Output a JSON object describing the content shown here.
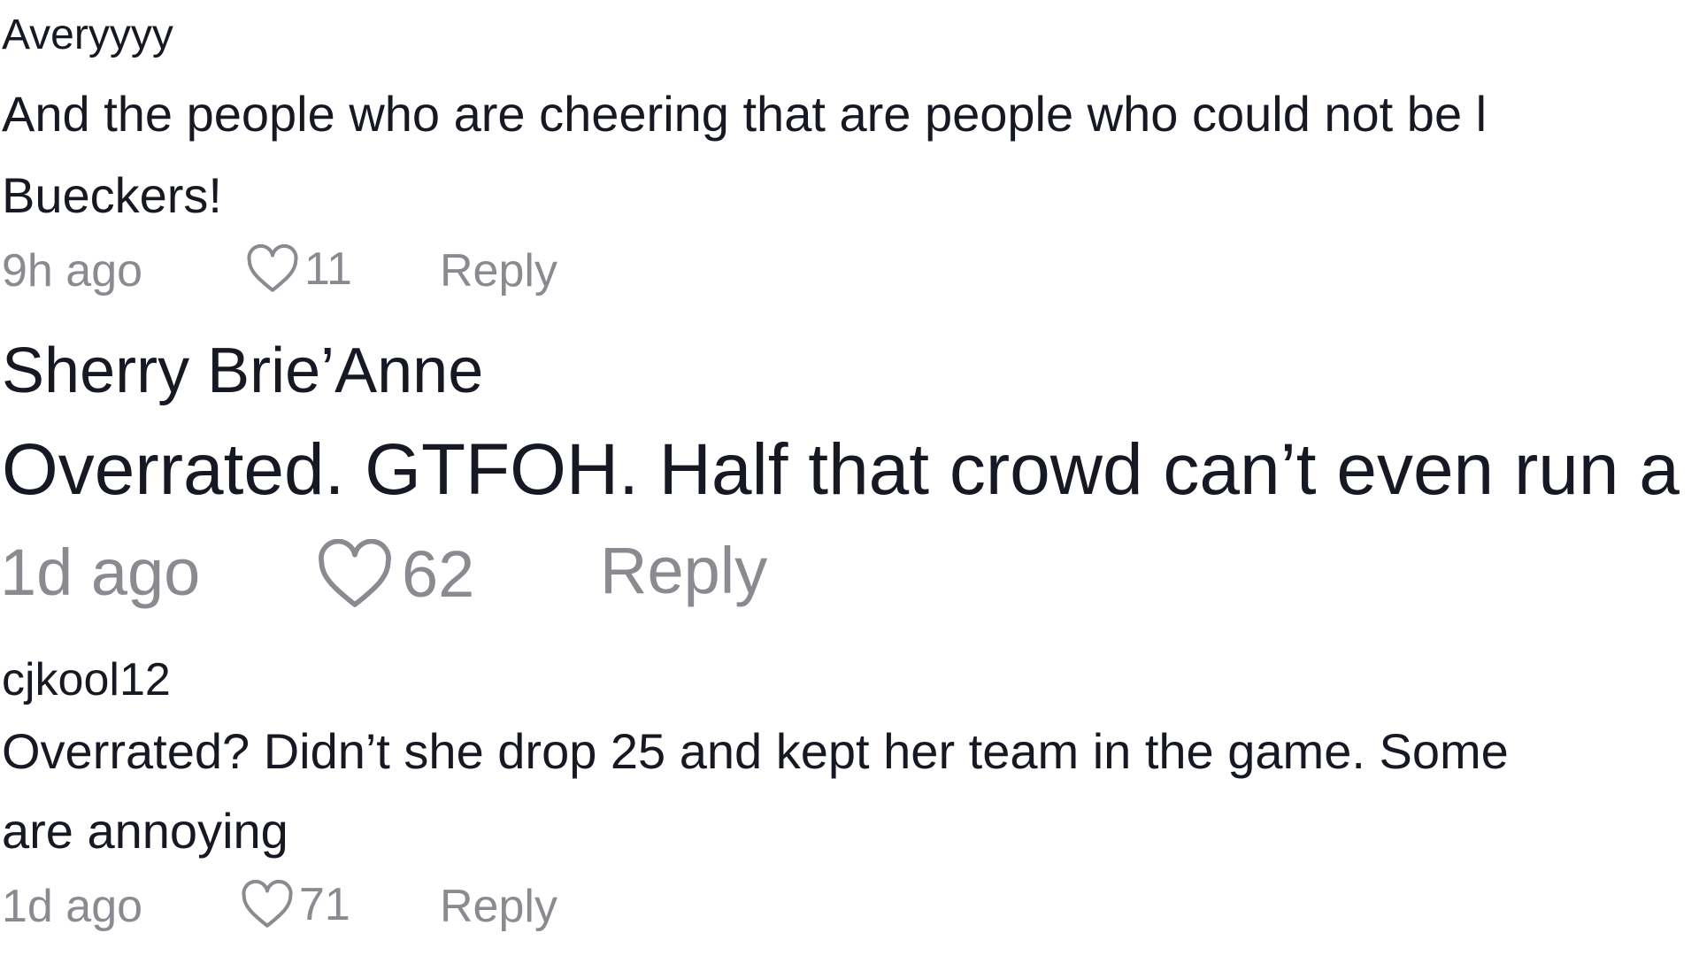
{
  "comments": [
    {
      "username": "Averyyyy",
      "lines": [
        "And the people who are cheering that are people who could not be l",
        "Bueckers!"
      ],
      "time": "9h ago",
      "likes": "11",
      "reply_label": "Reply"
    },
    {
      "username": "Sherry Brie’Anne",
      "lines": [
        "Overrated. GTFOH. Half that crowd can’t even run a"
      ],
      "time": "1d ago",
      "likes": "62",
      "reply_label": "Reply"
    },
    {
      "username": "cjkool12",
      "lines": [
        "Overrated? Didn’t she drop 25 and kept her team in the game. Some",
        "are annoying"
      ],
      "time": "1d ago",
      "likes": "71",
      "reply_label": "Reply"
    }
  ],
  "icons": {
    "like": "heart-outline-icon"
  },
  "colors": {
    "text": "#161823",
    "meta": "#8a8b91"
  }
}
